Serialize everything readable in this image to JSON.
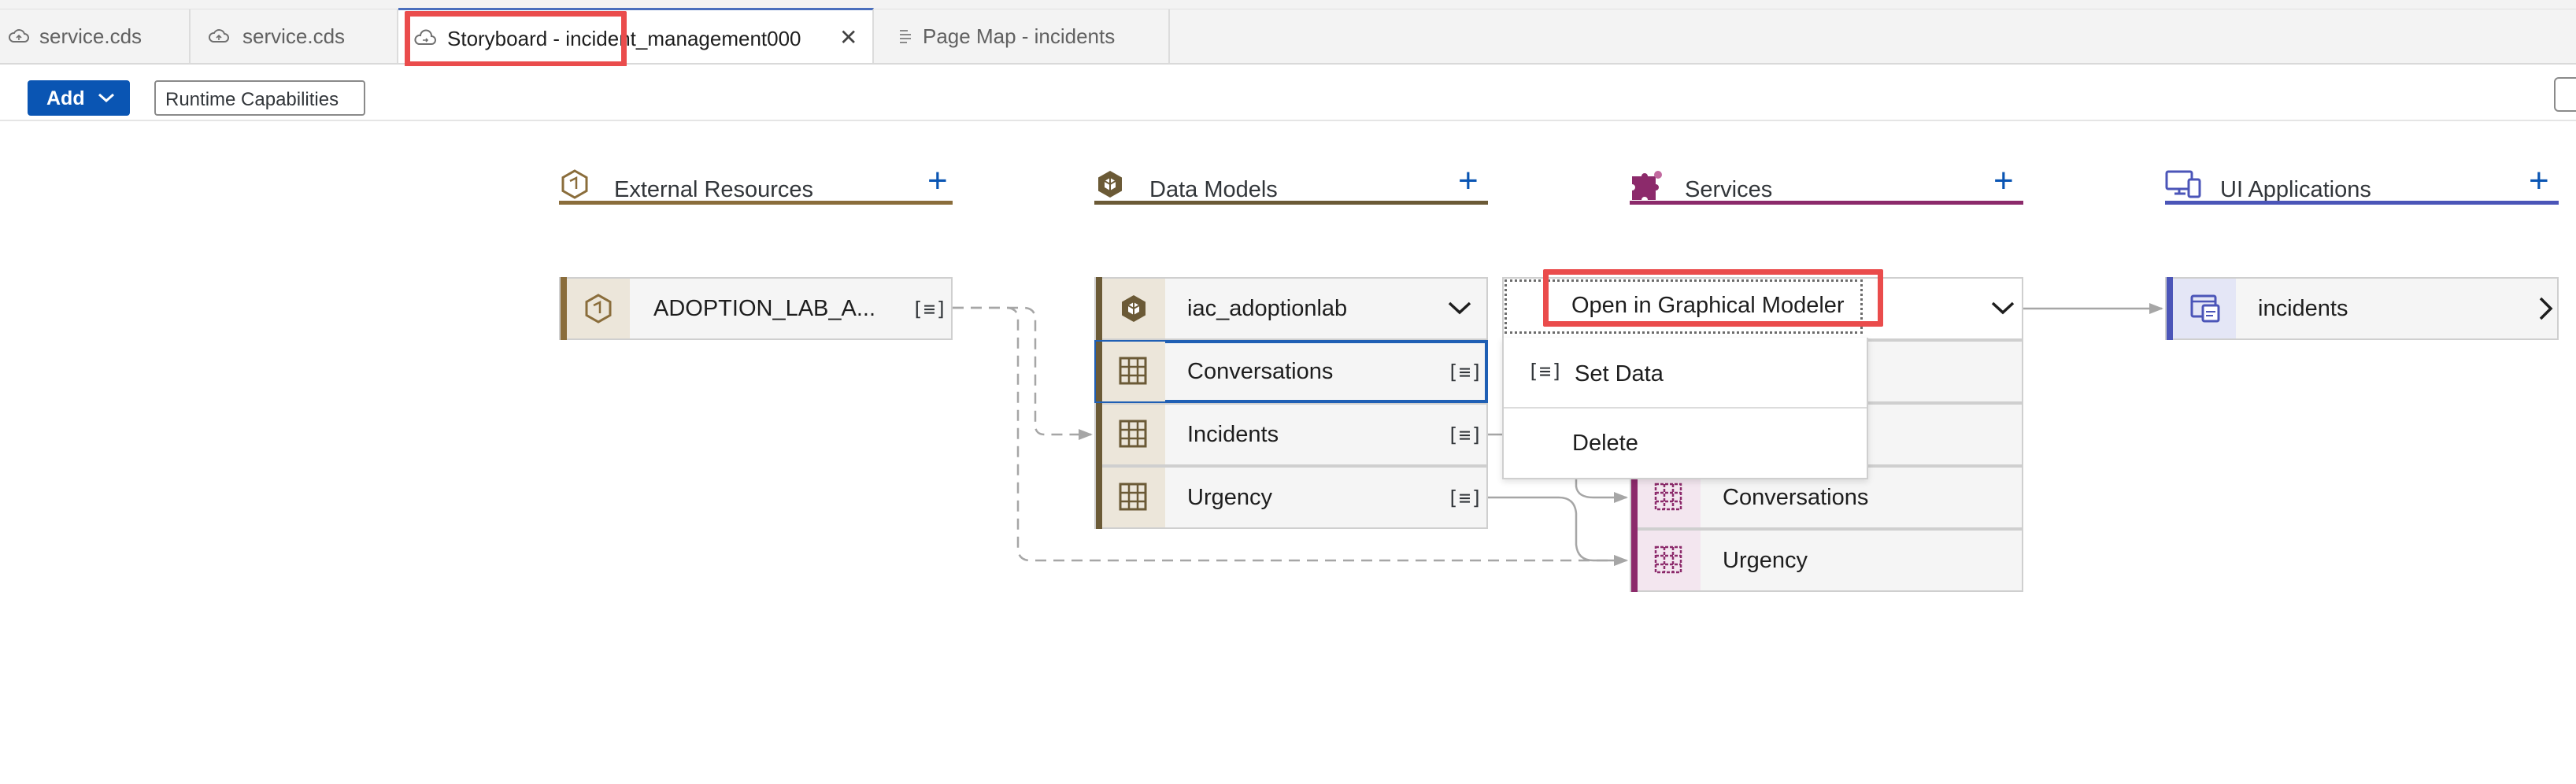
{
  "tabs": [
    {
      "label": "service.cds",
      "icon": "cloud-icon"
    },
    {
      "label": "service.cds",
      "icon": "cloud-icon"
    },
    {
      "label": "Storyboard - incident_management000",
      "icon": "cloud-icon",
      "active": true
    },
    {
      "label": "Page Map - incidents",
      "icon": "document-icon"
    }
  ],
  "close_glyph": "✕",
  "toolbar": {
    "add_label": "Add",
    "runtime_label": "Runtime Capabilities"
  },
  "columns": {
    "external": {
      "title": "External Resources",
      "plus": "+",
      "color": "#8a6d3b"
    },
    "datamodels": {
      "title": "Data Models",
      "plus": "+",
      "color": "#6b5a36"
    },
    "services": {
      "title": "Services",
      "plus": "+",
      "color": "#8c2a6b"
    },
    "ui": {
      "title": "UI Applications",
      "plus": "+",
      "color": "#4b55b8"
    }
  },
  "external_nodes": [
    {
      "name": "ADOPTION_LAB_A...",
      "action": "[≡]"
    }
  ],
  "datamodel_header": {
    "name": "iac_adoptionlab"
  },
  "datamodel_entities": [
    {
      "name": "Conversations",
      "action": "[≡]"
    },
    {
      "name": "Incidents",
      "action": "[≡]"
    },
    {
      "name": "Urgency",
      "action": "[≡]"
    }
  ],
  "service_entities": [
    {
      "name": "Conversations"
    },
    {
      "name": "Urgency"
    }
  ],
  "ui_nodes": [
    {
      "name": "incidents"
    }
  ],
  "context_menu": {
    "open_label": "Open in Graphical Modeler",
    "set_data_label": "Set Data",
    "set_data_icon": "[≡]",
    "delete_label": "Delete"
  }
}
